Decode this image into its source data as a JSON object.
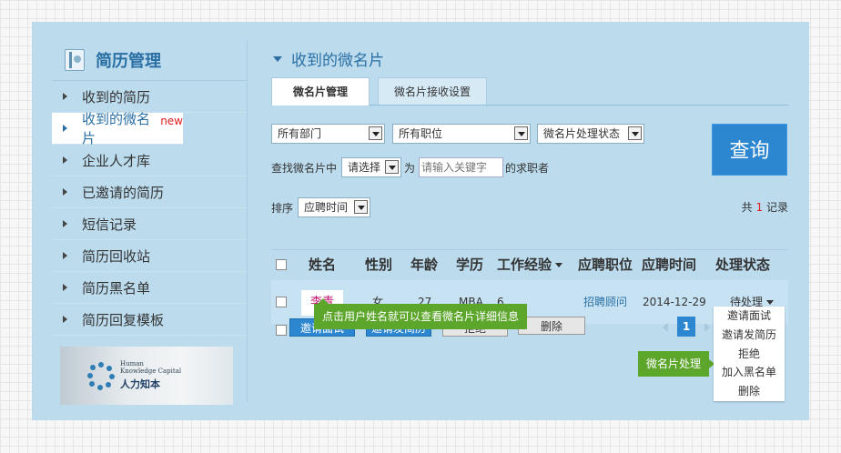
{
  "sidebar": {
    "title": "简历管理",
    "items": [
      {
        "label": "收到的简历"
      },
      {
        "label": "收到的微名片",
        "badge": "new"
      },
      {
        "label": "企业人才库"
      },
      {
        "label": "已邀请的简历"
      },
      {
        "label": "短信记录"
      },
      {
        "label": "简历回收站"
      },
      {
        "label": "简历黑名单"
      },
      {
        "label": "简历回复模板"
      }
    ],
    "logo": {
      "en_line1": "Human",
      "en_line2": "Knowledge Capital",
      "cn": "人力知本"
    }
  },
  "main": {
    "heading": "收到的微名片",
    "tabs": [
      {
        "label": "微名片管理"
      },
      {
        "label": "微名片接收设置"
      }
    ],
    "filters": {
      "department": "所有部门",
      "position": "所有职位",
      "status": "微名片处理状态",
      "search_prefix": "查找微名片中",
      "search_field": "请选择",
      "search_middle": "为",
      "keyword_placeholder": "请输入关键字",
      "search_suffix": "的求职者",
      "query_button": "查询"
    },
    "sort": {
      "label": "排序",
      "value": "应聘时间"
    },
    "count": {
      "prefix": "共",
      "value": "1",
      "suffix": "记录"
    },
    "columns": [
      "姓名",
      "性别",
      "年龄",
      "学历",
      "工作经验",
      "应聘职位",
      "应聘时间",
      "处理状态"
    ],
    "rows": [
      {
        "name": "李青",
        "gender": "女",
        "age": "27",
        "education": "MBA",
        "experience": "6",
        "position": "招聘顾问",
        "date": "2014-12-29",
        "status": "待处理"
      }
    ],
    "actions": {
      "invite_interview": "邀请面试",
      "invite_resume": "邀请发简历",
      "reject": "拒绝",
      "delete": "删除"
    },
    "tooltip_name": "点击用户姓名就可以查看微名片详细信息",
    "tooltip_process": "微名片处理",
    "status_menu": [
      "邀请面试",
      "邀请发简历",
      "拒绝",
      "加入黑名单",
      "删除"
    ],
    "pager": {
      "current": "1"
    }
  },
  "colors": {
    "panel": "#bcdcee",
    "accent": "#2a6fa4",
    "button": "#2d87d0",
    "tooltip": "#5da62c",
    "name": "#c0136f"
  }
}
